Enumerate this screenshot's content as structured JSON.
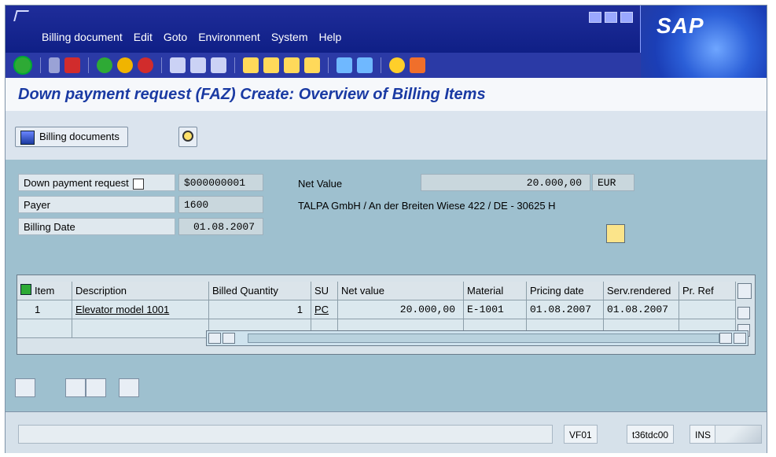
{
  "menu": [
    "Billing document",
    "Edit",
    "Goto",
    "Environment",
    "System",
    "Help"
  ],
  "brand": "SAP",
  "title": "Down payment request  (FAZ) Create: Overview of Billing Items",
  "app_toolbar": {
    "billing_documents": "Billing documents"
  },
  "header": {
    "doc_label": "Down payment request",
    "doc_value": "$000000001",
    "net_label": "Net Value",
    "net_value": "20.000,00",
    "currency": "EUR",
    "payer_label": "Payer",
    "payer_value": "1600",
    "payer_text": "TALPA GmbH / An der Breiten Wiese 422 / DE - 30625 H",
    "billing_date_label": "Billing Date",
    "billing_date_value": "01.08.2007"
  },
  "grid": {
    "columns": [
      "Item",
      "Description",
      "Billed Quantity",
      "SU",
      "Net value",
      "Material",
      "Pricing date",
      "Serv.rendered",
      "Pr. Ref"
    ],
    "rows": [
      {
        "item": "1",
        "description": "Elevator model 1001",
        "billed_qty": "1",
        "su": "PC",
        "net_value": "20.000,00",
        "material": "E-1001",
        "pricing_date": "01.08.2007",
        "serv_rendered": "01.08.2007",
        "pr_ref": ""
      }
    ]
  },
  "status": {
    "transaction": "VF01",
    "server": "t36tdc00",
    "mode": "INS"
  },
  "colors": {
    "menubar": "#0f1f86",
    "title": "#1a3aa3",
    "panel": "#9ec0cf"
  }
}
